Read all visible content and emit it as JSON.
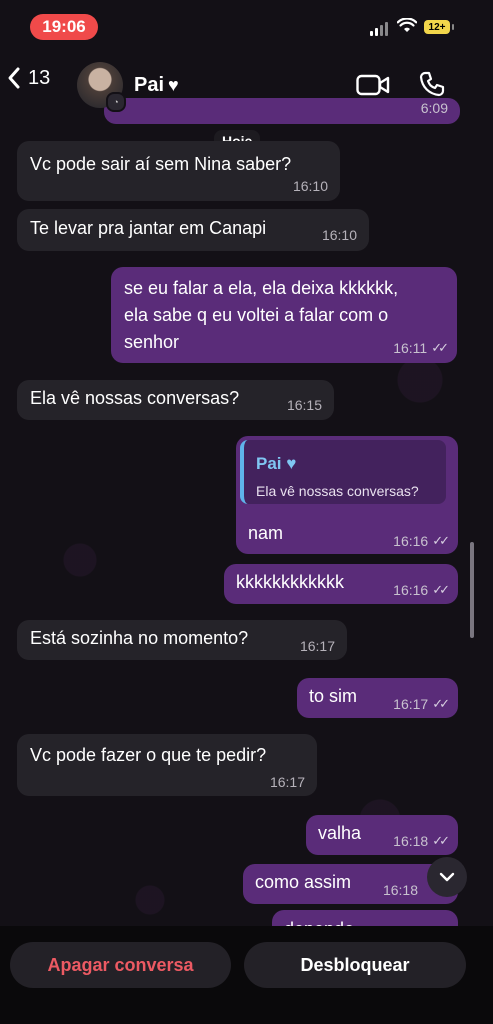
{
  "status_bar": {
    "time": "19:06",
    "battery": "12+"
  },
  "header": {
    "back_count": "13",
    "contact_name": "Pai",
    "heart": "♥",
    "icons": [
      "back-chevron-icon",
      "video-call-icon",
      "phone-icon"
    ]
  },
  "date_label": "Hoje",
  "partial_top_time": "6:09",
  "messages": [
    {
      "dir": "in",
      "text": "Vc pode sair aí sem Nina saber?",
      "time": "16:10"
    },
    {
      "dir": "in",
      "text": "Te levar pra jantar em Canapi",
      "time": "16:10"
    },
    {
      "dir": "out",
      "lines": [
        "se eu falar a ela, ela deixa kkkkkk,",
        "ela sabe q eu voltei a falar com o",
        "senhor"
      ],
      "time": "16:11"
    },
    {
      "dir": "in",
      "text": "Ela vê nossas conversas?",
      "time": "16:15"
    },
    {
      "dir": "out",
      "reply_to_name": "Pai",
      "reply_to_text": "Ela vê nossas conversas?",
      "text": "nam",
      "time": "16:16"
    },
    {
      "dir": "out",
      "text": "kkkkkkkkkkkk",
      "time": "16:16"
    },
    {
      "dir": "in",
      "text": "Está sozinha no momento?",
      "time": "16:17"
    },
    {
      "dir": "out",
      "text": "to sim",
      "time": "16:17"
    },
    {
      "dir": "in",
      "text": "Vc pode fazer o que te pedir?",
      "time": "16:17"
    },
    {
      "dir": "out",
      "text": "valha",
      "time": "16:18"
    },
    {
      "dir": "out",
      "text": "como assim",
      "time": "16:18"
    },
    {
      "dir": "out",
      "text": "depende",
      "time": ""
    }
  ],
  "actions": {
    "delete_label": "Apagar conversa",
    "unblock_label": "Desbloquear"
  },
  "colors": {
    "incoming": "#252329",
    "outgoing": "#5a2c79",
    "delete": "#ec5a63",
    "time_pill": "#f04a4a"
  }
}
